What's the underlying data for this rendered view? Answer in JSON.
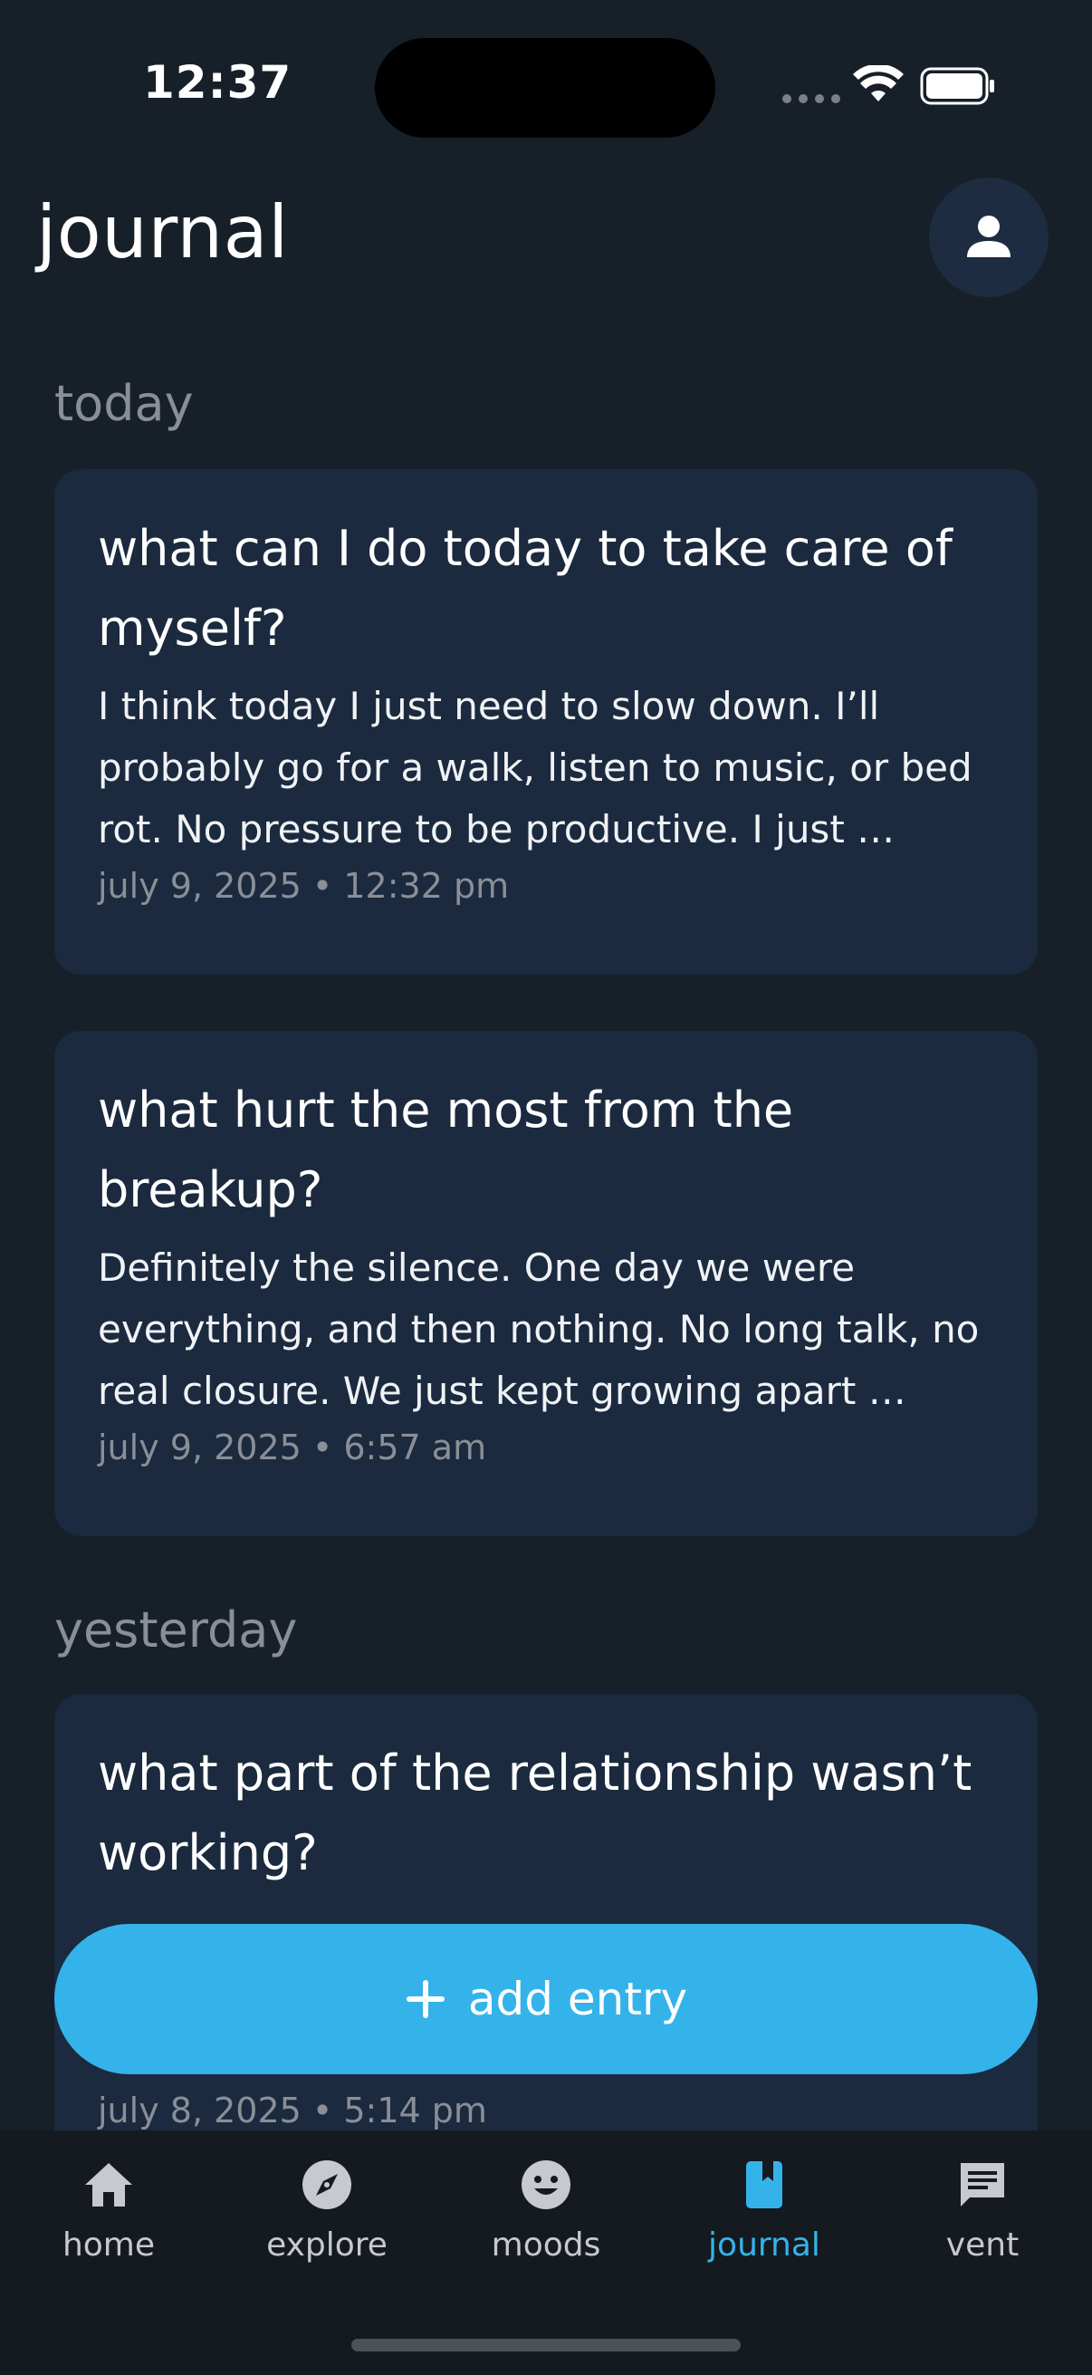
{
  "status_bar": {
    "time": "12:37"
  },
  "header": {
    "title": "journal"
  },
  "sections": [
    {
      "label": "today"
    },
    {
      "label": "yesterday"
    }
  ],
  "entries": [
    {
      "title": "what can I do today to take care of myself?",
      "body": "I think today I just need to slow down. I’ll probably go for a walk, listen to music, or bed rot. No pressure to be productive. I just …",
      "meta": "july 9, 2025 • 12:32 pm"
    },
    {
      "title": "what hurt the most from the breakup?",
      "body": "Definitely the silence. One day we were everything, and then nothing. No long talk, no real closure. We just kept growing apart …",
      "meta": "july 9, 2025 • 6:57 am"
    },
    {
      "title": "what part of the relationship wasn’t working?",
      "body": "",
      "meta": "july 8, 2025 • 5:14 pm"
    }
  ],
  "add_entry": {
    "label": "add entry"
  },
  "tabs": [
    {
      "label": "home",
      "icon": "home-icon"
    },
    {
      "label": "explore",
      "icon": "compass-icon"
    },
    {
      "label": "moods",
      "icon": "smiley-icon"
    },
    {
      "label": "journal",
      "icon": "journal-icon",
      "active": true
    },
    {
      "label": "vent",
      "icon": "chat-icon"
    }
  ],
  "colors": {
    "background": "#172029",
    "card": "#1b2a3e",
    "accent": "#34b3ea",
    "muted": "#8a8f97"
  }
}
